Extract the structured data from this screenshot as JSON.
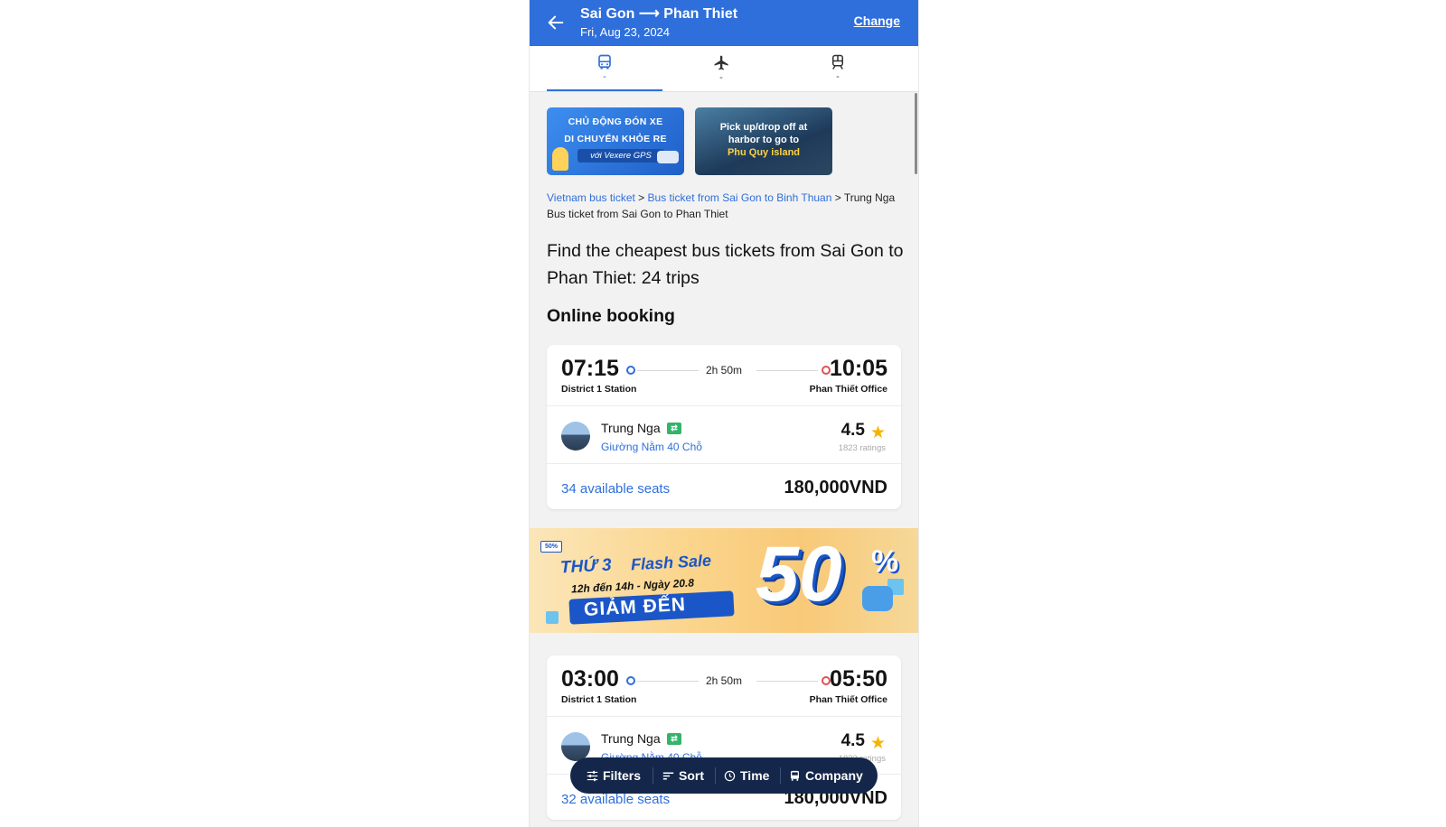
{
  "header": {
    "route": "Sai Gon ⟶ Phan Thiet",
    "date": "Fri, Aug 23, 2024",
    "change_label": "Change"
  },
  "tabs": [
    {
      "icon": "bus-icon",
      "sub": "-",
      "active": true
    },
    {
      "icon": "airplane-icon",
      "sub": "-",
      "active": false
    },
    {
      "icon": "train-icon",
      "sub": "-",
      "active": false
    }
  ],
  "banners": {
    "gps": {
      "line1": "CHỦ ĐỘNG ĐÓN XE",
      "line2": "DI CHUYỂN KHỎE RE",
      "line3": "với Vexere GPS"
    },
    "island": {
      "line1": "Pick up/drop off at",
      "line2": "harbor to go to",
      "line3": "Phu Quy island"
    }
  },
  "breadcrumb": {
    "link1": "Vietnam bus ticket",
    "sep1": " > ",
    "link2": "Bus ticket from Sai Gon to Binh Thuan",
    "sep2": " > ",
    "current": "Trung Nga Bus ticket from Sai Gon to Phan Thiet"
  },
  "heading": "Find the cheapest bus tickets from Sai Gon to Phan Thiet: 24 trips",
  "subheading": "Online booking",
  "trips": [
    {
      "departure_time": "07:15",
      "departure_station": "District 1 Station",
      "duration": "2h 50m",
      "arrival_time": "10:05",
      "arrival_station": "Phan Thiết Office",
      "company": "Trung Nga",
      "bus_type": "Giường Nằm 40 Chỗ",
      "rating": "4.5",
      "rating_count": "1823 ratings",
      "seats": "34 available seats",
      "price": "180,000VND"
    },
    {
      "departure_time": "03:00",
      "departure_station": "District 1 Station",
      "duration": "2h 50m",
      "arrival_time": "05:50",
      "arrival_station": "Phan Thiết Office",
      "company": "Trung Nga",
      "bus_type": "Giường Nằm 40 Chỗ",
      "rating": "4.5",
      "rating_count": "1823 ratings",
      "seats": "32 available seats",
      "price": "180,000VND"
    }
  ],
  "flash_sale": {
    "day": "THỨ 3",
    "title": "Flash Sale",
    "time": "12h đến 14h - Ngày 20.8",
    "discount_label": "GIẢM ĐẾN",
    "discount_value": "50",
    "percent": "%",
    "tag": "50%"
  },
  "filter_bar": {
    "filters": "Filters",
    "sort": "Sort",
    "time": "Time",
    "company": "Company"
  },
  "colors": {
    "primary": "#2f6fdb",
    "filter_bar": "#14264a",
    "rating_star": "#f5b400",
    "license_badge": "#34b36a"
  }
}
